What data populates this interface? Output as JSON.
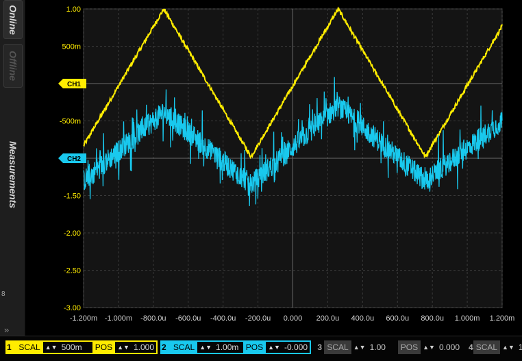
{
  "sidebar": {
    "tab_online": "Online",
    "tab_offline": "Offline",
    "measurements": "Measurements",
    "small_label": "8",
    "collapse_glyph": "»"
  },
  "colors": {
    "ch1": "#ffec00",
    "ch2": "#19c9ee",
    "grid": "#3a3a3a",
    "plot_bg": "#141414"
  },
  "chart_data": {
    "type": "line",
    "title": "",
    "x_ticks": [
      "-1.200m",
      "-1.000m",
      "-800.0u",
      "-600.0u",
      "-400.0u",
      "-200.0u",
      "0.000",
      "200.0u",
      "400.0u",
      "600.0u",
      "800.0u",
      "1.000m",
      "1.200m"
    ],
    "y_ticks": [
      "1.00",
      "500m",
      "0.00",
      "-500m",
      "-1.00",
      "-1.50",
      "-2.00",
      "-2.50",
      "-3.00"
    ],
    "xlim": [
      -0.0012,
      0.0012
    ],
    "ylim": [
      -3.0,
      1.0
    ],
    "grid": true,
    "markers": [
      {
        "label": "CH1",
        "y": 0.0,
        "color": "#ffec00"
      },
      {
        "label": "CH2",
        "y": -1.0,
        "color": "#19c9ee"
      }
    ],
    "series": [
      {
        "name": "CH1",
        "color": "#ffec00",
        "x": [
          -0.0012,
          -0.00074,
          -0.00024,
          0.00026,
          0.00076,
          0.0012
        ],
        "y": [
          -0.83,
          1.0,
          -0.98,
          1.0,
          -0.98,
          0.77
        ]
      },
      {
        "name": "CH2",
        "color": "#19c9ee",
        "x": [
          -0.0012,
          -0.00074,
          -0.00024,
          0.00026,
          0.00076,
          0.0012
        ],
        "y": [
          -1.3,
          -0.38,
          -1.35,
          -0.3,
          -1.3,
          -0.5
        ]
      }
    ]
  },
  "bottom": {
    "ch1": {
      "num": "1",
      "scale_label": "SCAL",
      "scale": "500m",
      "pos_label": "POS",
      "pos": "1.000"
    },
    "ch2": {
      "num": "2",
      "scale_label": "SCAL",
      "scale": "1.00m",
      "pos_label": "POS",
      "pos": "-0.000"
    },
    "ch3": {
      "num": "3",
      "scale_label": "SCAL",
      "scale": "1.00",
      "pos_label": "POS",
      "pos": "0.000"
    },
    "ch4": {
      "num": "4",
      "scale_label": "SCAL",
      "scale": "1"
    },
    "spin_glyph": "▲▼"
  }
}
